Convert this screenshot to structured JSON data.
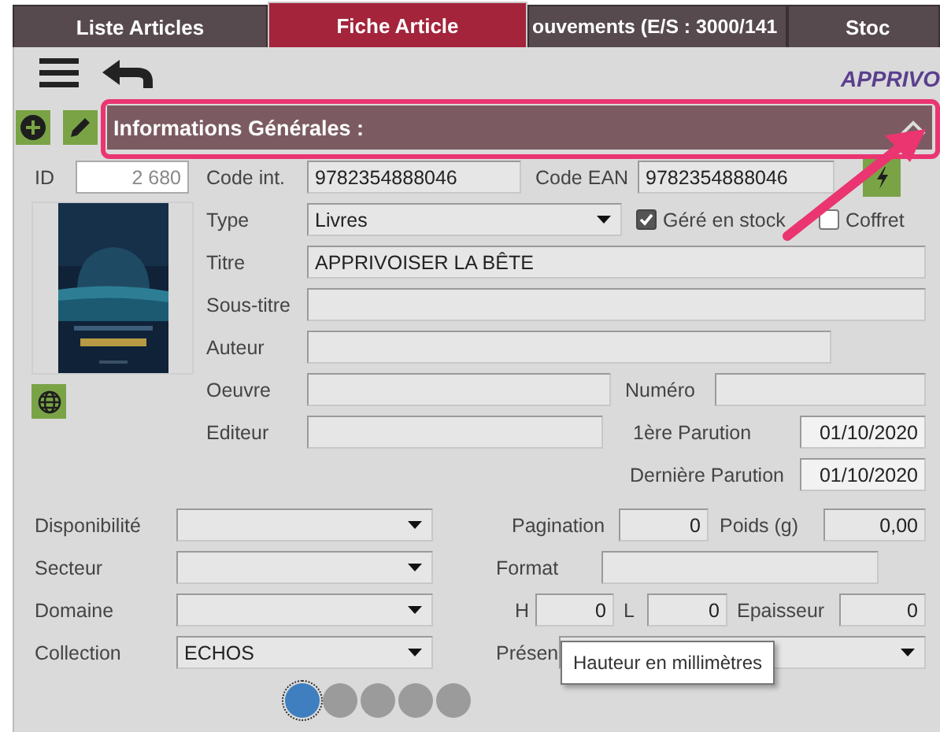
{
  "tabs": [
    {
      "label": "Liste Articles",
      "selected": false
    },
    {
      "label": "Fiche Article",
      "selected": true
    },
    {
      "label": "ouvements (E/S : 3000/141",
      "selected": false
    },
    {
      "label": "Stoc",
      "selected": false
    }
  ],
  "toolbar": {
    "heading": "APPRIVO"
  },
  "section": {
    "title": "Informations Générales :",
    "expanded": true
  },
  "rows": [
    [
      {
        "kind": "label",
        "text": "ID"
      },
      {
        "kind": "id",
        "value": "2 680"
      },
      {
        "kind": "label",
        "text": "Code int."
      },
      {
        "kind": "input",
        "value": "9782354888046"
      },
      {
        "kind": "label",
        "text": "Code EAN"
      },
      {
        "kind": "input",
        "value": "9782354888046"
      },
      {
        "kind": "bolt"
      }
    ],
    [
      {
        "kind": "label",
        "text": "Type"
      },
      {
        "kind": "select",
        "value": "Livres"
      },
      {
        "kind": "checkbox",
        "text": "Géré en stock",
        "checked": true
      },
      {
        "kind": "checkbox",
        "text": "Coffret",
        "checked": false
      }
    ],
    [
      {
        "kind": "label",
        "text": "Titre"
      },
      {
        "kind": "input",
        "value": "APPRIVOISER LA BÊTE"
      }
    ],
    [
      {
        "kind": "label",
        "text": "Sous-titre"
      },
      {
        "kind": "input"
      }
    ],
    [
      {
        "kind": "label",
        "text": "Auteur"
      },
      {
        "kind": "input"
      }
    ],
    [
      {
        "kind": "label",
        "text": "Oeuvre"
      },
      {
        "kind": "input"
      },
      {
        "kind": "label",
        "text": "Numéro"
      },
      {
        "kind": "input"
      }
    ],
    [
      {
        "kind": "label",
        "text": "Editeur"
      },
      {
        "kind": "input"
      },
      {
        "kind": "label",
        "text": "1ère Parution"
      },
      {
        "kind": "date",
        "value": "01/10/2020"
      }
    ],
    [
      {
        "kind": "label",
        "text": "Dernière Parution"
      },
      {
        "kind": "date",
        "value": "01/10/2020"
      }
    ],
    [
      {
        "kind": "label",
        "text": "Disponibilité"
      },
      {
        "kind": "select"
      },
      {
        "kind": "label",
        "text": "Pagination"
      },
      {
        "kind": "input",
        "value": "0"
      },
      {
        "kind": "label",
        "text": "Poids (g)"
      },
      {
        "kind": "input",
        "value": "0,00"
      }
    ],
    [
      {
        "kind": "label",
        "text": "Secteur"
      },
      {
        "kind": "select"
      },
      {
        "kind": "label",
        "text": "Format"
      },
      {
        "kind": "input"
      }
    ],
    [
      {
        "kind": "label",
        "text": "Domaine"
      },
      {
        "kind": "select"
      },
      {
        "kind": "label",
        "text": "H"
      },
      {
        "kind": "input",
        "value": "0"
      },
      {
        "kind": "label",
        "text": "L"
      },
      {
        "kind": "input",
        "value": "0"
      },
      {
        "kind": "label",
        "text": "Epaisseur"
      },
      {
        "kind": "input",
        "value": "0"
      }
    ],
    [
      {
        "kind": "label",
        "text": "Collection"
      },
      {
        "kind": "select",
        "value": "ECHOS"
      },
      {
        "kind": "label",
        "text": "Présen"
      },
      {
        "kind": "select"
      }
    ]
  ],
  "pager": [
    {
      "selected": true
    },
    {
      "selected": false
    },
    {
      "selected": false
    },
    {
      "selected": false
    },
    {
      "selected": false
    }
  ],
  "tooltip": {
    "text": "Hauteur en millimètres"
  }
}
